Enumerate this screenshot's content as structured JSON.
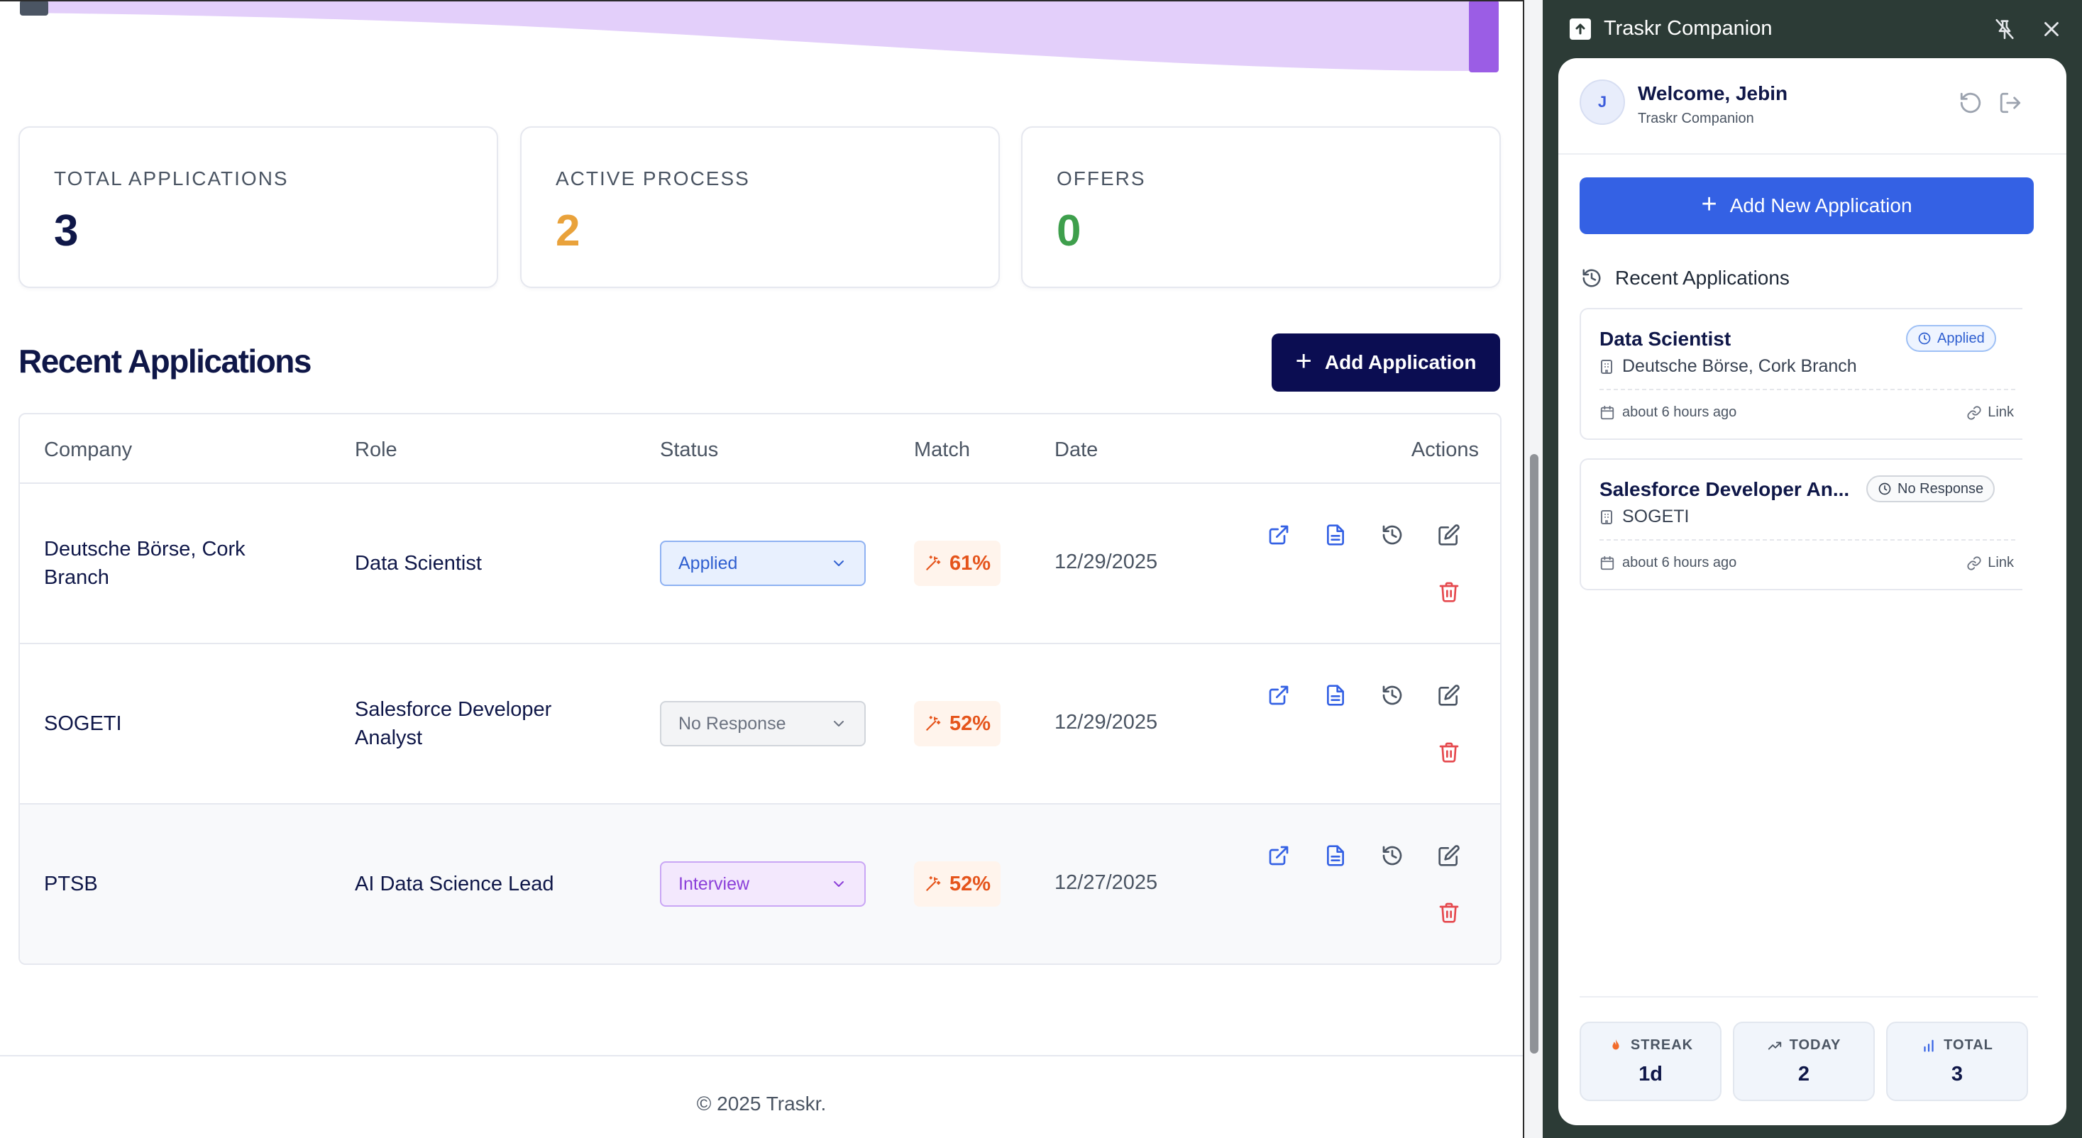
{
  "colors": {
    "navy": "#0f1748",
    "primary_blue": "#3461e4",
    "dark_button": "#0b0d52",
    "active_orange": "#e9a23b",
    "offers_green": "#3e9f4c",
    "delete_red": "#e5484d",
    "match_orange": "#e5541b",
    "banner_purple": "#e3cffa",
    "panel_bg": "#2c3b36"
  },
  "stats": [
    {
      "label": "TOTAL APPLICATIONS",
      "value": "3",
      "color": "#0f1748"
    },
    {
      "label": "ACTIVE PROCESS",
      "value": "2",
      "color": "#e9a23b"
    },
    {
      "label": "OFFERS",
      "value": "0",
      "color": "#3e9f4c"
    }
  ],
  "section": {
    "title": "Recent Applications",
    "add_button_label": "Add Application"
  },
  "table": {
    "headers": [
      "Company",
      "Role",
      "Status",
      "Match",
      "Date",
      "Actions"
    ],
    "rows": [
      {
        "company": "Deutsche Börse, Cork Branch",
        "role": "Data Scientist",
        "status": "Applied",
        "match": "61%",
        "date": "12/29/2025"
      },
      {
        "company": "SOGETI",
        "role": "Salesforce Developer Analyst",
        "status": "No Response",
        "match": "52%",
        "date": "12/29/2025"
      },
      {
        "company": "PTSB",
        "role": "AI Data Science Lead",
        "status": "Interview",
        "match": "52%",
        "date": "12/27/2025"
      }
    ],
    "action_icons": [
      "external-link-icon",
      "document-icon",
      "history-icon",
      "edit-icon",
      "trash-icon"
    ]
  },
  "footer": {
    "text": "© 2025 Traskr."
  },
  "panel": {
    "title": "Traskr Companion",
    "user": {
      "initial": "J",
      "welcome": "Welcome, Jebin",
      "subtitle": "Traskr Companion"
    },
    "add_button_label": "Add New Application",
    "recent_title": "Recent Applications",
    "applications": [
      {
        "title": "Data Scientist",
        "company": "Deutsche Börse, Cork Branch",
        "badge": "Applied",
        "time": "about 6 hours ago",
        "link_label": "Link"
      },
      {
        "title": "Salesforce Developer An...",
        "company": "SOGETI",
        "badge": "No Response",
        "time": "about 6 hours ago",
        "link_label": "Link"
      }
    ],
    "stats": [
      {
        "label": "STREAK",
        "value": "1d",
        "icon": "flame-icon"
      },
      {
        "label": "TODAY",
        "value": "2",
        "icon": "trending-up-icon"
      },
      {
        "label": "TOTAL",
        "value": "3",
        "icon": "bar-chart-icon"
      }
    ]
  }
}
